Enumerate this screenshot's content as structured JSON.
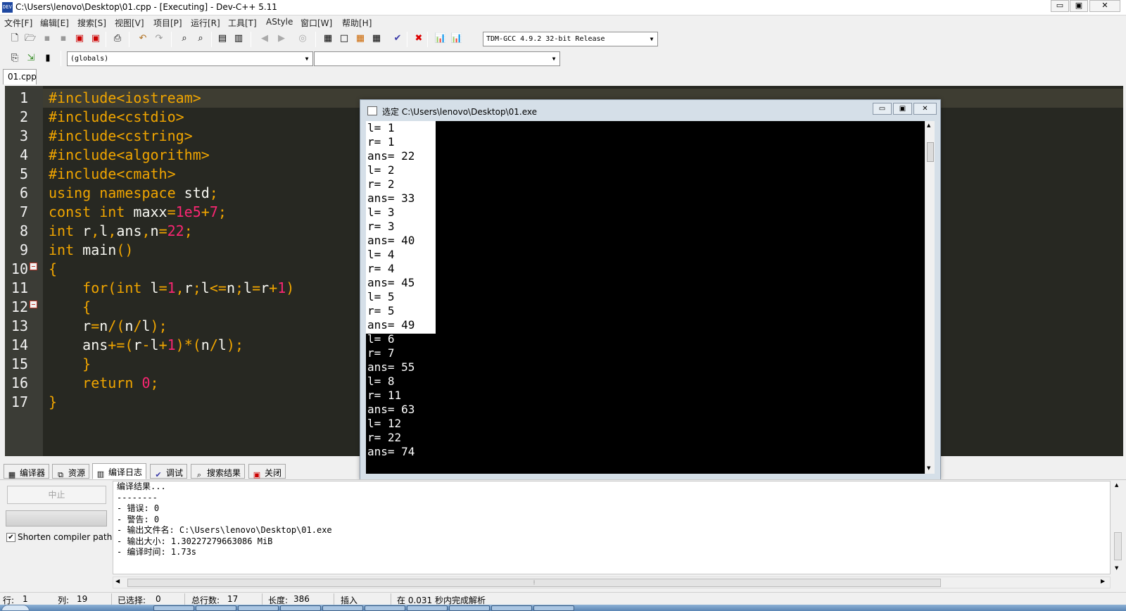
{
  "window": {
    "title": "C:\\Users\\lenovo\\Desktop\\01.cpp - [Executing] - Dev-C++ 5.11",
    "icon": "devcpp-icon",
    "buttons": {
      "minimize": "▭",
      "maximize": "▣",
      "close": "✕"
    }
  },
  "menu": [
    "文件[F]",
    "编辑[E]",
    "搜索[S]",
    "视图[V]",
    "项目[P]",
    "运行[R]",
    "工具[T]",
    "AStyle",
    "窗口[W]",
    "帮助[H]"
  ],
  "toolbar": {
    "compiler_select": "TDM-GCC 4.9.2 32-bit Release",
    "scope_select": "(globals)",
    "member_select": ""
  },
  "tabs": {
    "file": "01.cpp"
  },
  "editor": {
    "line_numbers": [
      "1",
      "2",
      "3",
      "4",
      "5",
      "6",
      "7",
      "8",
      "9",
      "10",
      "11",
      "12",
      "13",
      "14",
      "15",
      "16",
      "17"
    ],
    "current_line": 1,
    "colors": {
      "background": "#272822",
      "keyword": "#f0a500",
      "number": "#f92672",
      "text": "#f8f8f2"
    }
  },
  "console": {
    "title": "选定 C:\\Users\\lenovo\\Desktop\\01.exe",
    "lines": [
      "l= 1",
      "r= 1",
      "ans= 22",
      "l= 2",
      "r= 2",
      "ans= 33",
      "l= 3",
      "r= 3",
      "ans= 40",
      "l= 4",
      "r= 4",
      "ans= 45",
      "l= 5",
      "r= 5",
      "ans= 49",
      "l= 6",
      "r= 7",
      "ans= 55",
      "l= 8",
      "r= 11",
      "ans= 63",
      "l= 12",
      "r= 22",
      "ans= 74"
    ],
    "selected_line_count": 15
  },
  "bottom_tabs": [
    {
      "label": "编译器",
      "icon": "grid-icon"
    },
    {
      "label": "资源",
      "icon": "resource-icon"
    },
    {
      "label": "编译日志",
      "icon": "chart-icon",
      "active": true
    },
    {
      "label": "调试",
      "icon": "check-icon"
    },
    {
      "label": "搜索结果",
      "icon": "search-icon"
    },
    {
      "label": "关闭",
      "icon": "close-icon"
    }
  ],
  "compile_panel": {
    "abort_label": "中止",
    "shorten_label": "Shorten compiler paths",
    "shorten_checked": true,
    "log": [
      "编译结果...",
      "--------",
      "- 错误: 0",
      "- 警告: 0",
      "- 输出文件名: C:\\Users\\lenovo\\Desktop\\01.exe",
      "- 输出大小: 1.30227279663086 MiB",
      "- 编译时间: 1.73s"
    ]
  },
  "status": {
    "row_label": "行:",
    "row": "1",
    "col_label": "列:",
    "col": "19",
    "sel_label": "已选择:",
    "sel": "0",
    "total_label": "总行数:",
    "total": "17",
    "len_label": "长度:",
    "len": "386",
    "mode": "插入",
    "parse": "在 0.031 秒内完成解析"
  }
}
